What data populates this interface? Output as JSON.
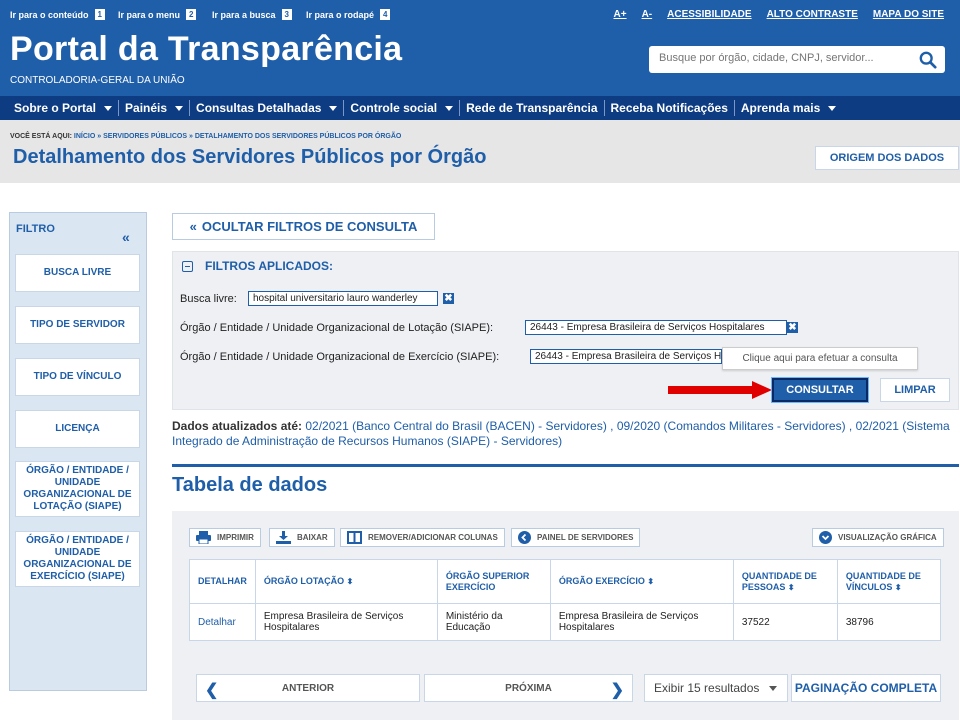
{
  "skip_links": [
    {
      "label": "Ir para o conteúdo",
      "key": "1"
    },
    {
      "label": "Ir para o menu",
      "key": "2"
    },
    {
      "label": "Ir para a busca",
      "key": "3"
    },
    {
      "label": "Ir para o rodapé",
      "key": "4"
    }
  ],
  "top_links": [
    "A+",
    "A-",
    "ACESSIBILIDADE",
    "ALTO CONTRASTE",
    "MAPA DO SITE"
  ],
  "brand": {
    "title": "Portal da Transparência",
    "subtitle": "CONTROLADORIA-GERAL DA UNIÃO"
  },
  "search": {
    "placeholder": "Busque por órgão, cidade, CNPJ, servidor..."
  },
  "nav": [
    {
      "label": "Sobre o Portal",
      "dropdown": true
    },
    {
      "label": "Painéis",
      "dropdown": true
    },
    {
      "label": "Consultas Detalhadas",
      "dropdown": true
    },
    {
      "label": "Controle social",
      "dropdown": true
    },
    {
      "label": "Rede de Transparência",
      "dropdown": false
    },
    {
      "label": "Receba Notificações",
      "dropdown": false
    },
    {
      "label": "Aprenda mais",
      "dropdown": true
    }
  ],
  "breadcrumb": {
    "prefix": "VOCÊ ESTÁ AQUI:",
    "items": [
      "INÍCIO",
      "SERVIDORES PÚBLICOS",
      "DETALHAMENTO DOS SERVIDORES PÚBLICOS POR ÓRGÃO"
    ],
    "sep": "»"
  },
  "page_title": "Detalhamento dos Servidores Públicos por Órgão",
  "origem_button": "ORIGEM DOS DADOS",
  "sidebar": {
    "title": "FILTRO",
    "collapse_glyph": "«",
    "items": [
      "BUSCA LIVRE",
      "TIPO DE SERVIDOR",
      "TIPO DE VÍNCULO",
      "LICENÇA",
      "ÓRGÃO / ENTIDADE / UNIDADE ORGANIZACIONAL DE LOTAÇÃO (SIAPE)",
      "ÓRGÃO / ENTIDADE / UNIDADE ORGANIZACIONAL DE EXERCÍCIO (SIAPE)"
    ]
  },
  "hide_filters_button": "OCULTAR FILTROS DE CONSULTA",
  "filters": {
    "heading": "FILTROS APLICADOS:",
    "busca_label": "Busca livre:",
    "busca_value": "hospital universitario lauro wanderley",
    "lotacao_label": "Órgão / Entidade / Unidade Organizacional de Lotação (SIAPE):",
    "lotacao_value": "26443 - Empresa Brasileira de Serviços Hospitalares",
    "exercicio_label": "Órgão / Entidade / Unidade Organizacional de Exercício (SIAPE):",
    "exercicio_value": "26443 - Empresa Brasileira de Serviços Hospitalares",
    "tooltip": "Clique aqui para efetuar a consulta",
    "consultar": "CONSULTAR",
    "limpar": "LIMPAR",
    "remove_glyph": "✖"
  },
  "updated": {
    "label": "Dados atualizados até:",
    "text": "02/2021 (Banco Central do Brasil (BACEN) - Servidores) , 09/2020 (Comandos Militares - Servidores) , 02/2021 (Sistema Integrado de Administração de Recursos Humanos (SIAPE) - Servidores)"
  },
  "section_title": "Tabela de dados",
  "toolbar": {
    "imprimir": "IMPRIMIR",
    "baixar": "BAIXAR",
    "colunas": "REMOVER/ADICIONAR COLUNAS",
    "painel": "PAINEL DE SERVIDORES",
    "grafica": "VISUALIZAÇÃO GRÁFICA"
  },
  "table": {
    "headers": [
      "DETALHAR",
      "ÓRGÃO LOTAÇÃO",
      "ÓRGÃO SUPERIOR EXERCÍCIO",
      "ÓRGÃO EXERCÍCIO",
      "QUANTIDADE DE PESSOAS",
      "QUANTIDADE DE VÍNCULOS"
    ],
    "sort_glyph": "⬍",
    "rows": [
      [
        "Detalhar",
        "Empresa Brasileira de Serviços Hospitalares",
        "Ministério da Educação",
        "Empresa Brasileira de Serviços Hospitalares",
        "37522",
        "38796"
      ]
    ]
  },
  "pagination": {
    "anterior": "ANTERIOR",
    "proxima": "PRÓXIMA",
    "prev_glyph": "❮",
    "next_glyph": "❯",
    "per_page": "Exibir 15 resultados",
    "full": "PAGINAÇÃO COMPLETA"
  },
  "colors": {
    "primary": "#1f5ea8",
    "nav": "#0d3c82",
    "arrow": "#e00000"
  }
}
